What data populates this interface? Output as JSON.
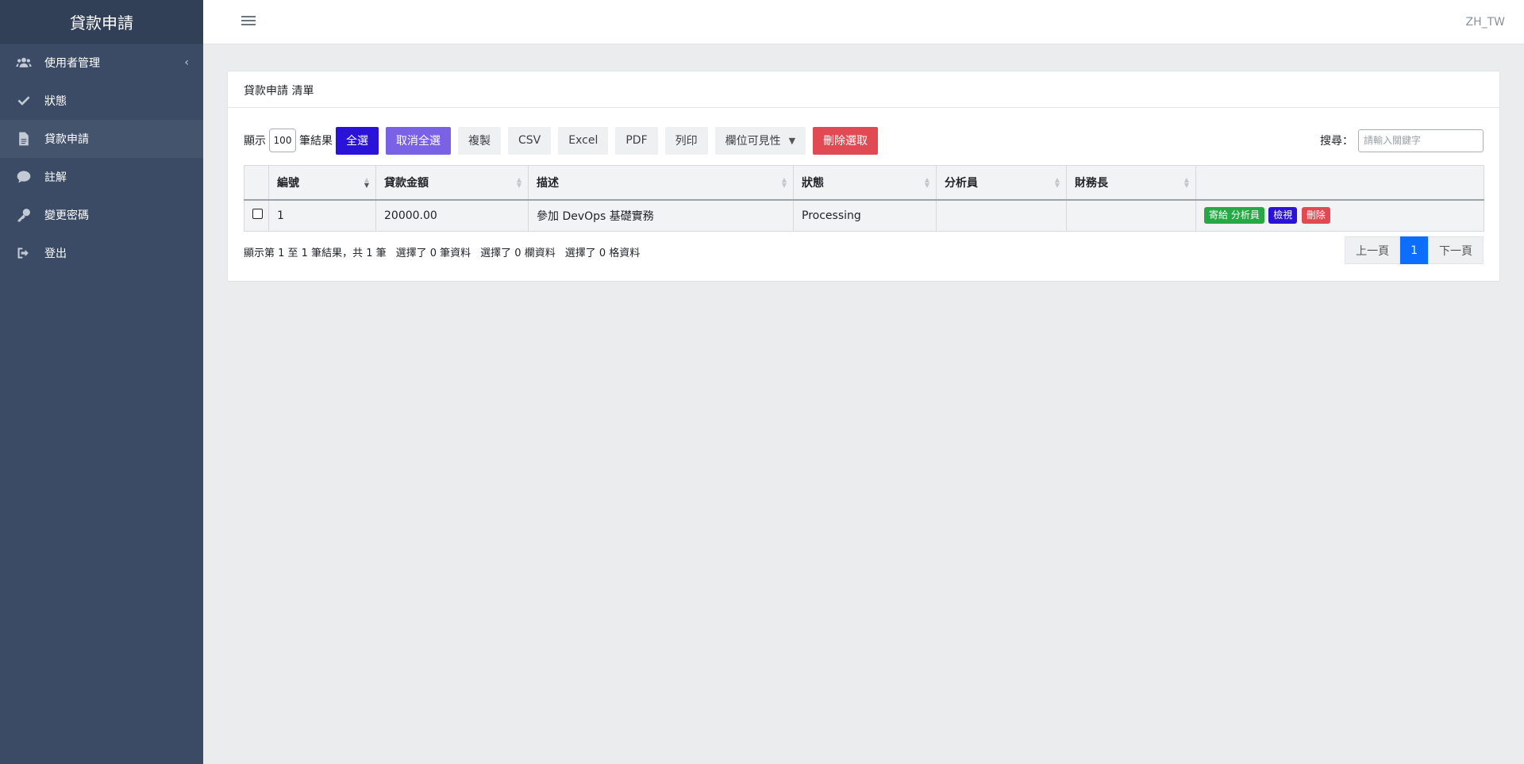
{
  "sidebar": {
    "brand": "貸款申請",
    "items": [
      {
        "label": "使用者管理",
        "icon": "users-icon",
        "has_caret": true
      },
      {
        "label": "狀態",
        "icon": "check-icon"
      },
      {
        "label": "貸款申請",
        "icon": "file-icon",
        "active": true
      },
      {
        "label": "註解",
        "icon": "comment-icon"
      },
      {
        "label": "變更密碼",
        "icon": "key-icon"
      },
      {
        "label": "登出",
        "icon": "sign-out-icon"
      }
    ]
  },
  "topbar": {
    "locale": "ZH_TW"
  },
  "card": {
    "title": "貸款申請 清單"
  },
  "toolbar": {
    "show_label": "顯示",
    "page_length": "100",
    "results_label": "筆結果",
    "select_all": "全選",
    "deselect_all": "取消全選",
    "copy": "複製",
    "csv": "CSV",
    "excel": "Excel",
    "pdf": "PDF",
    "print": "列印",
    "column_visibility": "欄位可見性",
    "delete_selected": "刪除選取",
    "search_label": "搜尋：",
    "search_placeholder": "請輸入關鍵字"
  },
  "table": {
    "columns": [
      "編號",
      "貸款金額",
      "描述",
      "狀態",
      "分析員",
      "財務長"
    ],
    "rows": [
      {
        "id": "1",
        "amount": "20000.00",
        "description": "參加 DevOps 基礎實務",
        "status": "Processing",
        "analyst": "",
        "cfo": "",
        "actions": [
          "寄給 分析員",
          "檢視",
          "刪除"
        ]
      }
    ]
  },
  "footer": {
    "info": "顯示第 1 至 1 筆結果，共 1 筆",
    "selected_rows": "選擇了 0 筆資料",
    "selected_columns": "選擇了 0 欄資料",
    "selected_cells": "選擇了 0 格資料",
    "prev": "上一頁",
    "current_page": "1",
    "next": "下一頁"
  },
  "colors": {
    "sidebar_bg": "#3b4b65",
    "primary": "#2b12d8",
    "danger": "#e24a53",
    "success": "#28a745",
    "page_active": "#0d6efd"
  }
}
